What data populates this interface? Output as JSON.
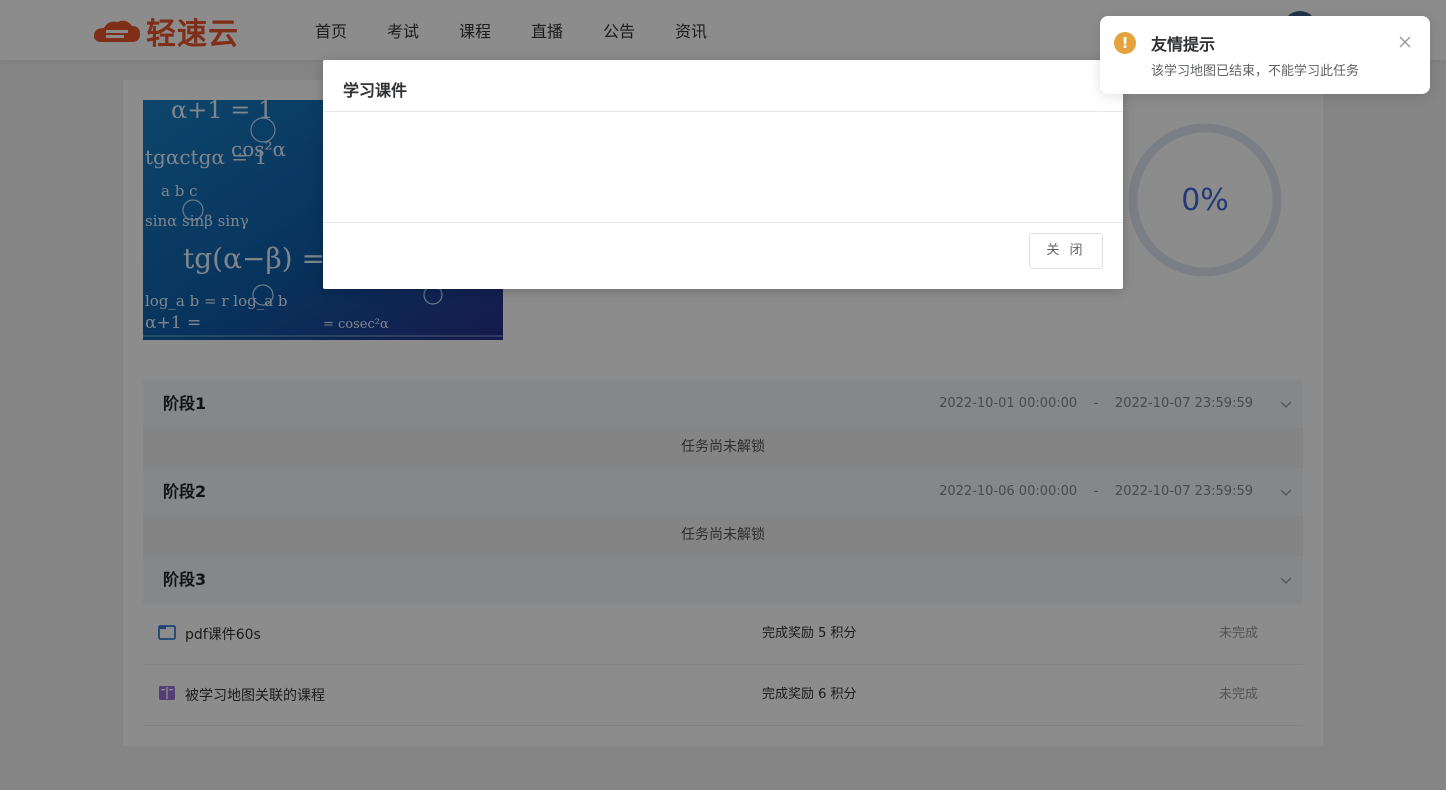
{
  "brand": {
    "name": "轻速云",
    "color": "#e8542a"
  },
  "nav": {
    "items": [
      "首页",
      "考试",
      "课程",
      "直播",
      "公告",
      "资讯"
    ]
  },
  "course": {
    "progress": "0%",
    "progress_value": 0,
    "stages": [
      {
        "title": "阶段1",
        "dates": "2022-10-01 00:00:00    -    2022-10-07 23:59:59",
        "locked_text": "任务尚未解锁"
      },
      {
        "title": "阶段2",
        "dates": "2022-10-06 00:00:00    -    2022-10-07 23:59:59",
        "locked_text": "任务尚未解锁"
      },
      {
        "title": "阶段3",
        "dates": ""
      }
    ],
    "tasks": [
      {
        "icon": "folder-icon",
        "name": "pdf课件60s",
        "reward": "完成奖励 5 积分",
        "status": "未完成"
      },
      {
        "icon": "book-icon",
        "name": "被学习地图关联的课程",
        "reward": "完成奖励 6 积分",
        "status": "未完成"
      }
    ]
  },
  "modal": {
    "title": "学习课件",
    "close_label": "关 闭"
  },
  "notification": {
    "title": "友情提示",
    "message": "该学习地图已结束，不能学习此任务",
    "icon": "!",
    "color": "#e6a23c"
  },
  "cover_formulas": [
    "α+1 = 1",
    "cos²α",
    "tgαctgα = 1",
    "a   b   c",
    "sinα  sinβ  sinγ",
    "tg(α−β) =",
    "log_a b = r log_a b",
    "α+1 =",
    "= cosec²α"
  ]
}
